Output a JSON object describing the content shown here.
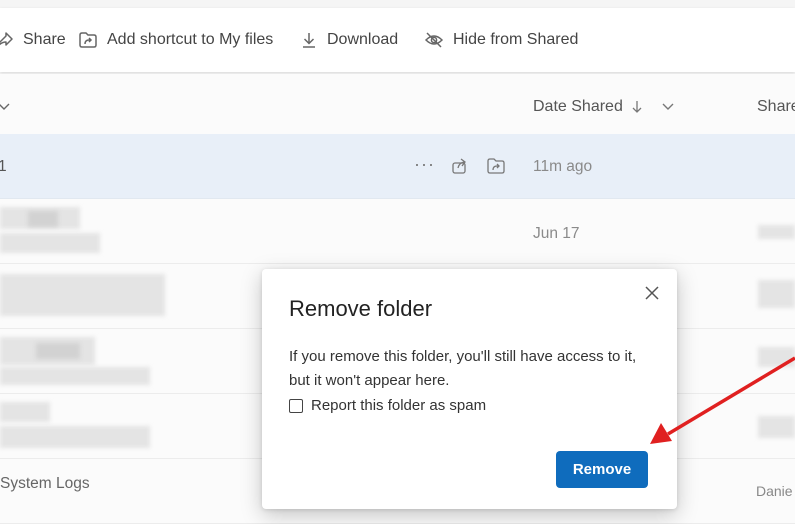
{
  "toolbar": {
    "share_label": "Share",
    "add_shortcut_label": "Add shortcut to My files",
    "download_label": "Download",
    "hide_label": "Hide from Shared"
  },
  "list": {
    "col_date_shared": "Date Shared",
    "col_shared_by_partial": "Share",
    "sort_icon": "arrow-down-icon",
    "rows": [
      {
        "name_partial": "1",
        "date": "11m ago",
        "selected": true
      },
      {
        "date": "Jun 17"
      },
      {},
      {},
      {},
      {
        "name_partial": "System Logs",
        "shared_by_partial": "Danie"
      }
    ]
  },
  "dialog": {
    "title": "Remove folder",
    "body": "If you remove this folder, you'll still have access to it, but it won't appear here.",
    "checkbox_label": "Report this folder as spam",
    "checkbox_checked": false,
    "remove_label": "Remove"
  },
  "colors": {
    "accent": "#0f6cbd",
    "selected_row": "#e8eff8",
    "annotation_arrow": "#e02020"
  }
}
